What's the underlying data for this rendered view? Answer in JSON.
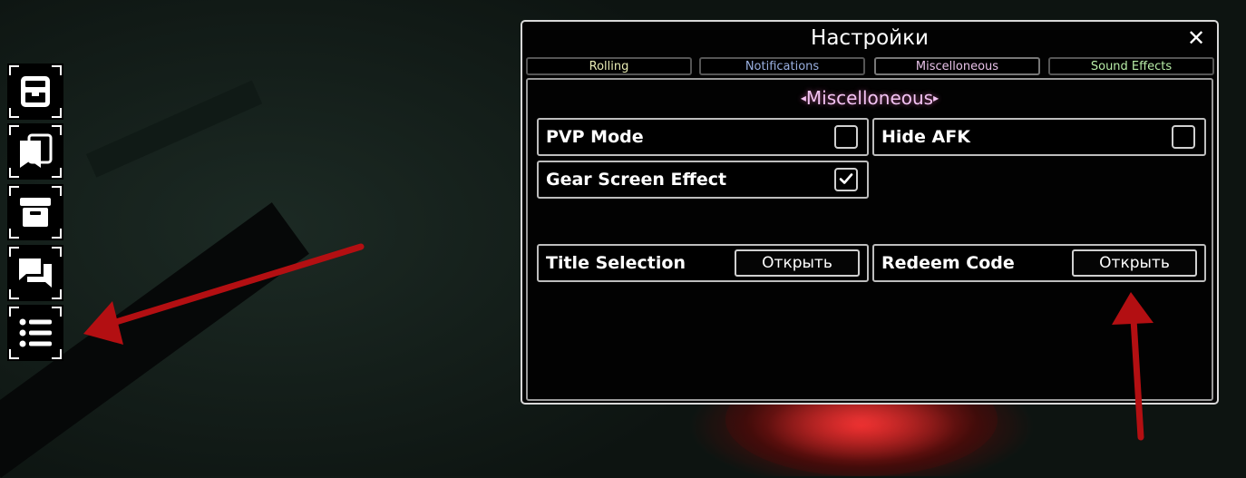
{
  "settings": {
    "title": "Настройки",
    "close_glyph": "✕",
    "tabs": [
      {
        "label": "Rolling",
        "color": "#e9ecb4"
      },
      {
        "label": "Notifications",
        "color": "#9ab0e0"
      },
      {
        "label": "Miscelloneous",
        "color": "#e8c2e8"
      },
      {
        "label": "Sound Effects",
        "color": "#b9eea8"
      }
    ],
    "section_title": "Miscelloneous",
    "section_prev_glyph": "◂",
    "section_next_glyph": "▸",
    "toggles": [
      {
        "label": "PVP Mode",
        "checked": false
      },
      {
        "label": "Hide AFK",
        "checked": false
      },
      {
        "label": "Gear Screen Effect",
        "checked": true
      }
    ],
    "actions": [
      {
        "label": "Title Selection",
        "button": "Открыть"
      },
      {
        "label": "Redeem Code",
        "button": "Открыть"
      }
    ]
  },
  "sidebar": {
    "buttons": [
      "inventory-icon",
      "collection-icon",
      "storage-box-icon",
      "chat-icon",
      "menu-list-icon"
    ]
  },
  "colors": {
    "arrow": "#b30f12",
    "section_title": "#f3c3f3"
  }
}
